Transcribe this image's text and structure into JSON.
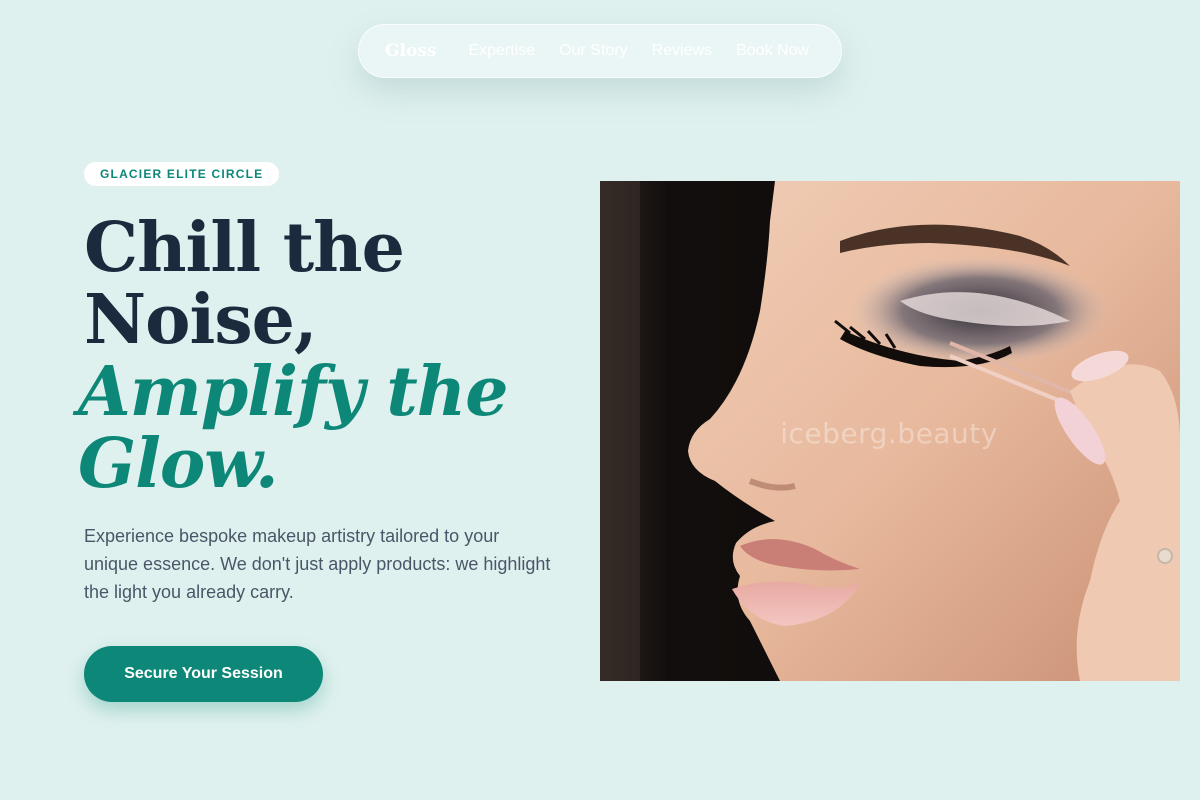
{
  "nav": {
    "logo": "Gloss",
    "links": [
      "Expertise",
      "Our Story",
      "Reviews",
      "Book Now"
    ]
  },
  "hero": {
    "badge": "GLACIER ELITE CIRCLE",
    "headline_line1": "Chill the",
    "headline_line2": "Noise,",
    "headline_accent1": "Amplify the",
    "headline_accent2": "Glow.",
    "description": "Experience bespoke makeup artistry tailored to your unique essence. We don't just apply products: we highlight the light you already carry.",
    "cta_label": "Secure Your Session",
    "image_watermark": "iceberg.beauty"
  },
  "colors": {
    "background": "#dff1ef",
    "accent": "#0d8777",
    "heading_dark": "#1c2a3d",
    "body_text": "#4a5668"
  }
}
